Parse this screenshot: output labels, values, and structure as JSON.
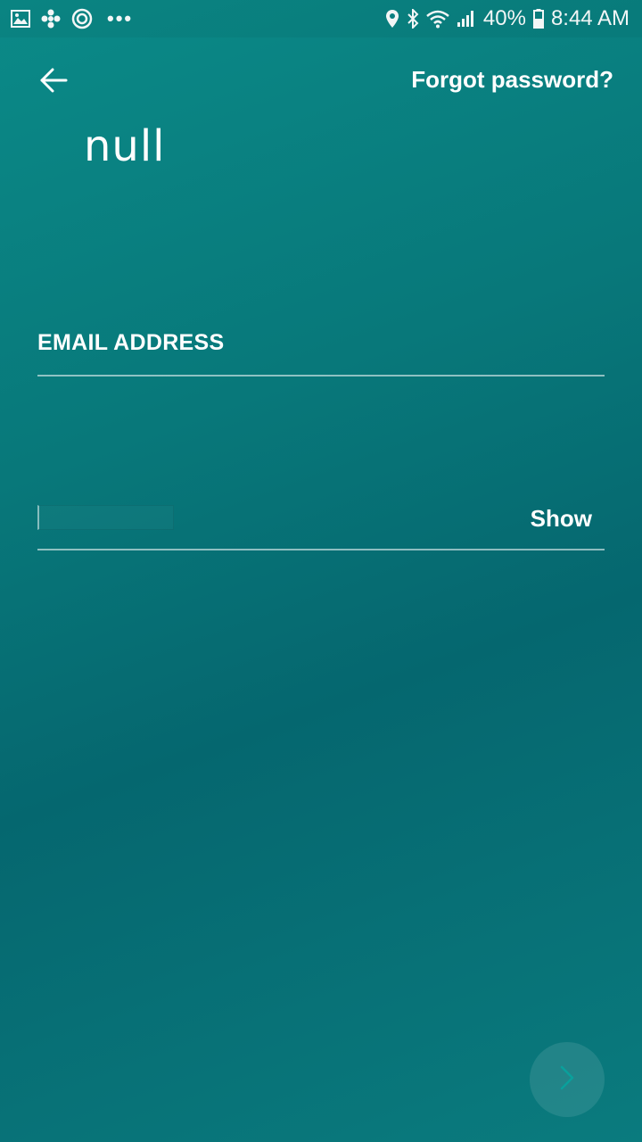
{
  "status_bar": {
    "icons_left": [
      "gallery-icon",
      "fan-icon",
      "sync-icon"
    ],
    "overflow": "•••",
    "icons_right": [
      "location-icon",
      "bluetooth-icon",
      "wifi-icon",
      "signal-icon"
    ],
    "battery_percent": "40%",
    "time": "8:44 AM"
  },
  "header": {
    "back_icon": "arrow-left-icon",
    "forgot_label": "Forgot password?"
  },
  "user": {
    "name": "null"
  },
  "form": {
    "email_label": "EMAIL ADDRESS",
    "password_value": "",
    "show_label": "Show"
  },
  "footer": {
    "next_icon": "chevron-right-icon"
  },
  "colors": {
    "background_start": "#0b8a88",
    "background_end": "#05676f",
    "text": "#ffffff"
  }
}
